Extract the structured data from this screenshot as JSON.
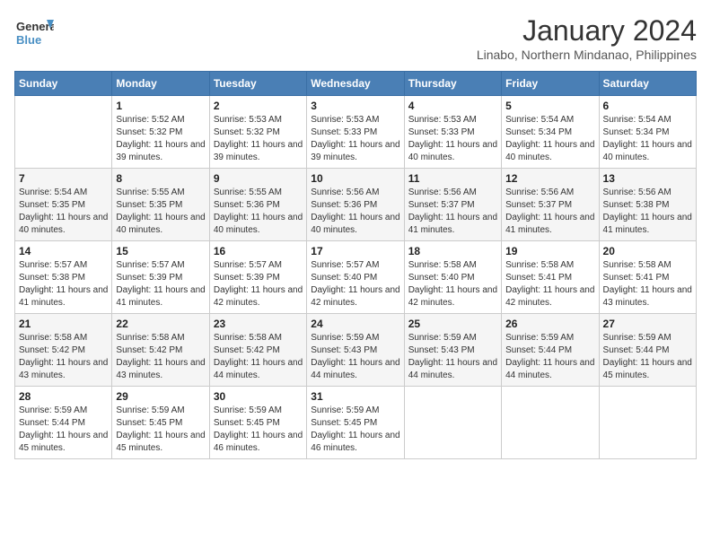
{
  "header": {
    "logo_line1": "General",
    "logo_line2": "Blue",
    "month": "January 2024",
    "location": "Linabo, Northern Mindanao, Philippines"
  },
  "weekdays": [
    "Sunday",
    "Monday",
    "Tuesday",
    "Wednesday",
    "Thursday",
    "Friday",
    "Saturday"
  ],
  "weeks": [
    [
      {
        "day": "",
        "sunrise": "",
        "sunset": "",
        "daylight": ""
      },
      {
        "day": "1",
        "sunrise": "5:52 AM",
        "sunset": "5:32 PM",
        "daylight": "11 hours and 39 minutes."
      },
      {
        "day": "2",
        "sunrise": "5:53 AM",
        "sunset": "5:32 PM",
        "daylight": "11 hours and 39 minutes."
      },
      {
        "day": "3",
        "sunrise": "5:53 AM",
        "sunset": "5:33 PM",
        "daylight": "11 hours and 39 minutes."
      },
      {
        "day": "4",
        "sunrise": "5:53 AM",
        "sunset": "5:33 PM",
        "daylight": "11 hours and 40 minutes."
      },
      {
        "day": "5",
        "sunrise": "5:54 AM",
        "sunset": "5:34 PM",
        "daylight": "11 hours and 40 minutes."
      },
      {
        "day": "6",
        "sunrise": "5:54 AM",
        "sunset": "5:34 PM",
        "daylight": "11 hours and 40 minutes."
      }
    ],
    [
      {
        "day": "7",
        "sunrise": "5:54 AM",
        "sunset": "5:35 PM",
        "daylight": "11 hours and 40 minutes."
      },
      {
        "day": "8",
        "sunrise": "5:55 AM",
        "sunset": "5:35 PM",
        "daylight": "11 hours and 40 minutes."
      },
      {
        "day": "9",
        "sunrise": "5:55 AM",
        "sunset": "5:36 PM",
        "daylight": "11 hours and 40 minutes."
      },
      {
        "day": "10",
        "sunrise": "5:56 AM",
        "sunset": "5:36 PM",
        "daylight": "11 hours and 40 minutes."
      },
      {
        "day": "11",
        "sunrise": "5:56 AM",
        "sunset": "5:37 PM",
        "daylight": "11 hours and 41 minutes."
      },
      {
        "day": "12",
        "sunrise": "5:56 AM",
        "sunset": "5:37 PM",
        "daylight": "11 hours and 41 minutes."
      },
      {
        "day": "13",
        "sunrise": "5:56 AM",
        "sunset": "5:38 PM",
        "daylight": "11 hours and 41 minutes."
      }
    ],
    [
      {
        "day": "14",
        "sunrise": "5:57 AM",
        "sunset": "5:38 PM",
        "daylight": "11 hours and 41 minutes."
      },
      {
        "day": "15",
        "sunrise": "5:57 AM",
        "sunset": "5:39 PM",
        "daylight": "11 hours and 41 minutes."
      },
      {
        "day": "16",
        "sunrise": "5:57 AM",
        "sunset": "5:39 PM",
        "daylight": "11 hours and 42 minutes."
      },
      {
        "day": "17",
        "sunrise": "5:57 AM",
        "sunset": "5:40 PM",
        "daylight": "11 hours and 42 minutes."
      },
      {
        "day": "18",
        "sunrise": "5:58 AM",
        "sunset": "5:40 PM",
        "daylight": "11 hours and 42 minutes."
      },
      {
        "day": "19",
        "sunrise": "5:58 AM",
        "sunset": "5:41 PM",
        "daylight": "11 hours and 42 minutes."
      },
      {
        "day": "20",
        "sunrise": "5:58 AM",
        "sunset": "5:41 PM",
        "daylight": "11 hours and 43 minutes."
      }
    ],
    [
      {
        "day": "21",
        "sunrise": "5:58 AM",
        "sunset": "5:42 PM",
        "daylight": "11 hours and 43 minutes."
      },
      {
        "day": "22",
        "sunrise": "5:58 AM",
        "sunset": "5:42 PM",
        "daylight": "11 hours and 43 minutes."
      },
      {
        "day": "23",
        "sunrise": "5:58 AM",
        "sunset": "5:42 PM",
        "daylight": "11 hours and 44 minutes."
      },
      {
        "day": "24",
        "sunrise": "5:59 AM",
        "sunset": "5:43 PM",
        "daylight": "11 hours and 44 minutes."
      },
      {
        "day": "25",
        "sunrise": "5:59 AM",
        "sunset": "5:43 PM",
        "daylight": "11 hours and 44 minutes."
      },
      {
        "day": "26",
        "sunrise": "5:59 AM",
        "sunset": "5:44 PM",
        "daylight": "11 hours and 44 minutes."
      },
      {
        "day": "27",
        "sunrise": "5:59 AM",
        "sunset": "5:44 PM",
        "daylight": "11 hours and 45 minutes."
      }
    ],
    [
      {
        "day": "28",
        "sunrise": "5:59 AM",
        "sunset": "5:44 PM",
        "daylight": "11 hours and 45 minutes."
      },
      {
        "day": "29",
        "sunrise": "5:59 AM",
        "sunset": "5:45 PM",
        "daylight": "11 hours and 45 minutes."
      },
      {
        "day": "30",
        "sunrise": "5:59 AM",
        "sunset": "5:45 PM",
        "daylight": "11 hours and 46 minutes."
      },
      {
        "day": "31",
        "sunrise": "5:59 AM",
        "sunset": "5:45 PM",
        "daylight": "11 hours and 46 minutes."
      },
      {
        "day": "",
        "sunrise": "",
        "sunset": "",
        "daylight": ""
      },
      {
        "day": "",
        "sunrise": "",
        "sunset": "",
        "daylight": ""
      },
      {
        "day": "",
        "sunrise": "",
        "sunset": "",
        "daylight": ""
      }
    ]
  ]
}
